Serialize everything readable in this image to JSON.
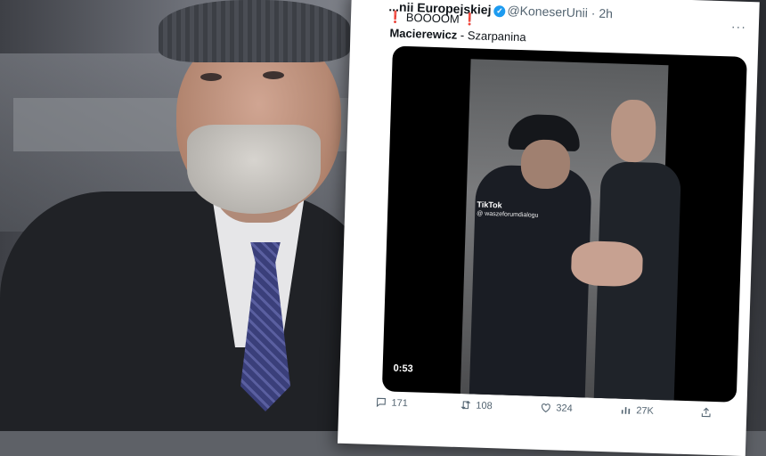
{
  "tweet": {
    "account_name": "...nii Europejskiej",
    "handle": "@KoneserUnii",
    "time": "2h",
    "more": "···",
    "line1_bang_left": "❗",
    "line1_text": "BOOOOM",
    "line1_bang_right": "❗",
    "line2_bold": "Macierewicz",
    "line2_rest": " - Szarpanina",
    "video": {
      "duration": "0:53",
      "watermark": "TikTok",
      "watermark_user": "@ waszeforumdialogu"
    },
    "actions": {
      "replies": "171",
      "reposts": "108",
      "likes": "324",
      "views": "27K"
    }
  },
  "icons": {
    "reply": "comment-icon",
    "repost": "repost-icon",
    "like": "heart-icon",
    "views": "views-icon",
    "verified": "verified-badge-icon"
  },
  "colors": {
    "verified": "#1d9bf0",
    "text": "#0f1419",
    "muted": "#536471",
    "accent_red": "#e0245e"
  }
}
